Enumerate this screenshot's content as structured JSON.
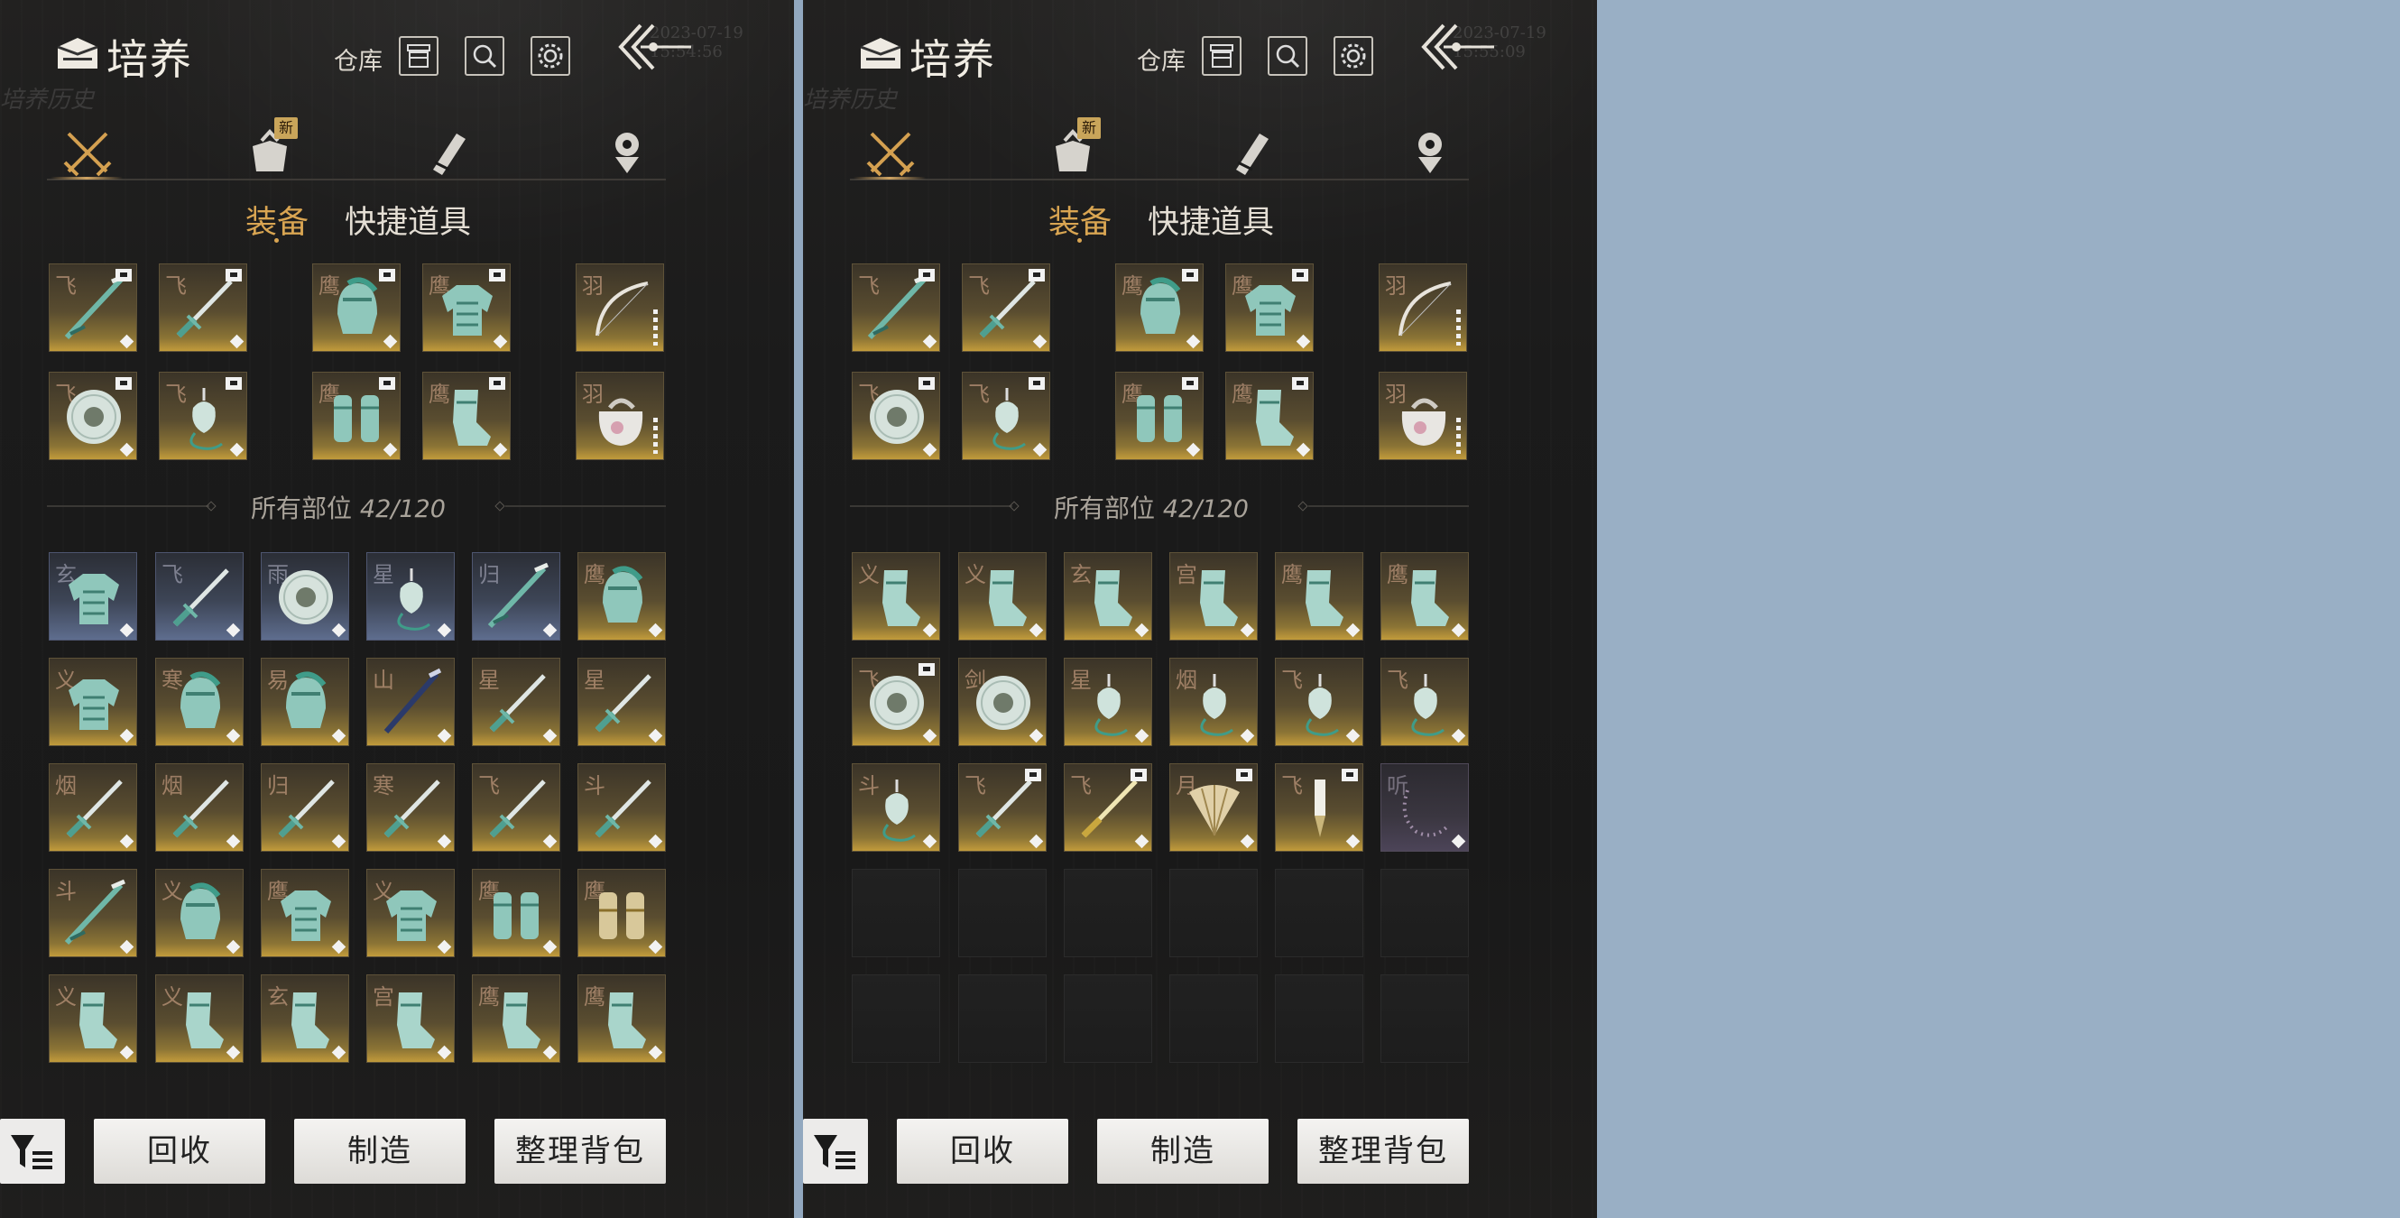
{
  "panels": [
    {
      "header": {
        "title": "培养",
        "warehouse_label": "仓库",
        "watermark_time": "2023-07-19 15:54:56",
        "watermark_text": "培养历史"
      },
      "tabs": [
        {
          "name": "weapon-tab",
          "icon": "crossed-swords-icon",
          "active": true
        },
        {
          "name": "bag-tab",
          "icon": "cloth-bag-icon",
          "badge": "新"
        },
        {
          "name": "scroll-tab",
          "icon": "scroll-icon"
        },
        {
          "name": "token-tab",
          "icon": "token-icon"
        }
      ],
      "subtabs": [
        {
          "label": "装备",
          "active": true
        },
        {
          "label": "快捷道具"
        }
      ],
      "equipped": [
        {
          "mark": "飞",
          "item": "spear"
        },
        {
          "mark": "飞",
          "item": "sword"
        },
        {
          "mark": "鹰",
          "item": "helmet"
        },
        {
          "mark": "鹰",
          "item": "armor"
        },
        {
          "mark": "羽",
          "item": "bow"
        },
        {
          "mark": "飞",
          "item": "ring"
        },
        {
          "mark": "飞",
          "item": "pendant"
        },
        {
          "mark": "鹰",
          "item": "bracers"
        },
        {
          "mark": "鹰",
          "item": "boots"
        },
        {
          "mark": "羽",
          "item": "pouch"
        }
      ],
      "inventory_label": "所有部位",
      "inventory_count": "42/120",
      "inventory": [
        {
          "mark": "玄",
          "item": "armor",
          "rarity": "blue"
        },
        {
          "mark": "飞",
          "item": "sword",
          "rarity": "blue"
        },
        {
          "mark": "雨",
          "item": "ring",
          "rarity": "blue"
        },
        {
          "mark": "星",
          "item": "pendant",
          "rarity": "blue"
        },
        {
          "mark": "归",
          "item": "spear",
          "rarity": "blue"
        },
        {
          "mark": "鹰",
          "item": "helmet",
          "rarity": "gold"
        },
        {
          "mark": "义",
          "item": "armor",
          "rarity": "gold"
        },
        {
          "mark": "寒",
          "item": "helmet",
          "rarity": "gold"
        },
        {
          "mark": "易",
          "item": "helmet",
          "rarity": "gold"
        },
        {
          "mark": "山",
          "item": "dark-spear",
          "rarity": "gold"
        },
        {
          "mark": "星",
          "item": "sword",
          "rarity": "gold"
        },
        {
          "mark": "星",
          "item": "sword",
          "rarity": "gold"
        },
        {
          "mark": "烟",
          "item": "sword",
          "rarity": "gold"
        },
        {
          "mark": "烟",
          "item": "sword",
          "rarity": "gold"
        },
        {
          "mark": "归",
          "item": "sword",
          "rarity": "gold"
        },
        {
          "mark": "寒",
          "item": "sword",
          "rarity": "gold"
        },
        {
          "mark": "飞",
          "item": "sword",
          "rarity": "gold"
        },
        {
          "mark": "斗",
          "item": "sword",
          "rarity": "gold"
        },
        {
          "mark": "斗",
          "item": "spear",
          "rarity": "gold"
        },
        {
          "mark": "义",
          "item": "helmet",
          "rarity": "gold"
        },
        {
          "mark": "鹰",
          "item": "armor",
          "rarity": "gold"
        },
        {
          "mark": "义",
          "item": "armor",
          "rarity": "gold"
        },
        {
          "mark": "鹰",
          "item": "bracers",
          "rarity": "gold"
        },
        {
          "mark": "鹰",
          "item": "gold-bracers",
          "rarity": "gold"
        },
        {
          "mark": "义",
          "item": "boots",
          "rarity": "gold"
        },
        {
          "mark": "义",
          "item": "boots",
          "rarity": "gold"
        },
        {
          "mark": "玄",
          "item": "boots",
          "rarity": "gold"
        },
        {
          "mark": "宫",
          "item": "boots",
          "rarity": "gold"
        },
        {
          "mark": "鹰",
          "item": "boots",
          "rarity": "gold"
        },
        {
          "mark": "鹰",
          "item": "boots",
          "rarity": "gold"
        }
      ],
      "buttons": {
        "recycle": "回收",
        "craft": "制造",
        "sort": "整理背包"
      }
    },
    {
      "header": {
        "title": "培养",
        "warehouse_label": "仓库",
        "watermark_time": "2023-07-19 15:55:09",
        "watermark_text": "培养历史"
      },
      "tabs": [
        {
          "name": "weapon-tab",
          "icon": "crossed-swords-icon",
          "active": true
        },
        {
          "name": "bag-tab",
          "icon": "cloth-bag-icon",
          "badge": "新"
        },
        {
          "name": "scroll-tab",
          "icon": "scroll-icon"
        },
        {
          "name": "token-tab",
          "icon": "token-icon"
        }
      ],
      "subtabs": [
        {
          "label": "装备",
          "active": true
        },
        {
          "label": "快捷道具"
        }
      ],
      "equipped": [
        {
          "mark": "飞",
          "item": "spear"
        },
        {
          "mark": "飞",
          "item": "sword"
        },
        {
          "mark": "鹰",
          "item": "helmet"
        },
        {
          "mark": "鹰",
          "item": "armor"
        },
        {
          "mark": "羽",
          "item": "bow"
        },
        {
          "mark": "飞",
          "item": "ring"
        },
        {
          "mark": "飞",
          "item": "pendant"
        },
        {
          "mark": "鹰",
          "item": "bracers"
        },
        {
          "mark": "鹰",
          "item": "boots"
        },
        {
          "mark": "羽",
          "item": "pouch"
        }
      ],
      "inventory_label": "所有部位",
      "inventory_count": "42/120",
      "inventory": [
        {
          "mark": "义",
          "item": "boots",
          "rarity": "gold"
        },
        {
          "mark": "义",
          "item": "boots",
          "rarity": "gold"
        },
        {
          "mark": "玄",
          "item": "boots",
          "rarity": "gold"
        },
        {
          "mark": "宫",
          "item": "boots",
          "rarity": "gold"
        },
        {
          "mark": "鹰",
          "item": "boots",
          "rarity": "gold"
        },
        {
          "mark": "鹰",
          "item": "boots",
          "rarity": "gold"
        },
        {
          "mark": "飞",
          "item": "ring",
          "rarity": "gold",
          "locked": true
        },
        {
          "mark": "剑",
          "item": "ring",
          "rarity": "gold"
        },
        {
          "mark": "星",
          "item": "pendant",
          "rarity": "gold"
        },
        {
          "mark": "烟",
          "item": "pendant",
          "rarity": "gold"
        },
        {
          "mark": "飞",
          "item": "pendant",
          "rarity": "gold"
        },
        {
          "mark": "飞",
          "item": "pendant",
          "rarity": "gold"
        },
        {
          "mark": "斗",
          "item": "pendant",
          "rarity": "gold"
        },
        {
          "mark": "飞",
          "item": "sword",
          "rarity": "gold",
          "locked": true
        },
        {
          "mark": "飞",
          "item": "gold-sword",
          "rarity": "gold",
          "locked": true
        },
        {
          "mark": "月",
          "item": "fan",
          "rarity": "gold",
          "locked": true
        },
        {
          "mark": "飞",
          "item": "brush",
          "rarity": "gold",
          "locked": true
        },
        {
          "mark": "听",
          "item": "beads",
          "rarity": "purple"
        },
        {
          "empty": true
        },
        {
          "empty": true
        },
        {
          "empty": true
        },
        {
          "empty": true
        },
        {
          "empty": true
        },
        {
          "empty": true
        },
        {
          "empty": true
        },
        {
          "empty": true
        },
        {
          "empty": true
        },
        {
          "empty": true
        },
        {
          "empty": true
        },
        {
          "empty": true
        }
      ],
      "buttons": {
        "recycle": "回收",
        "craft": "制造",
        "sort": "整理背包"
      }
    }
  ],
  "colors": {
    "accent": "#d9a552",
    "gold_slot": "#c29b3b",
    "blue_slot": "#5e6d8e",
    "background": "#99afc5"
  }
}
